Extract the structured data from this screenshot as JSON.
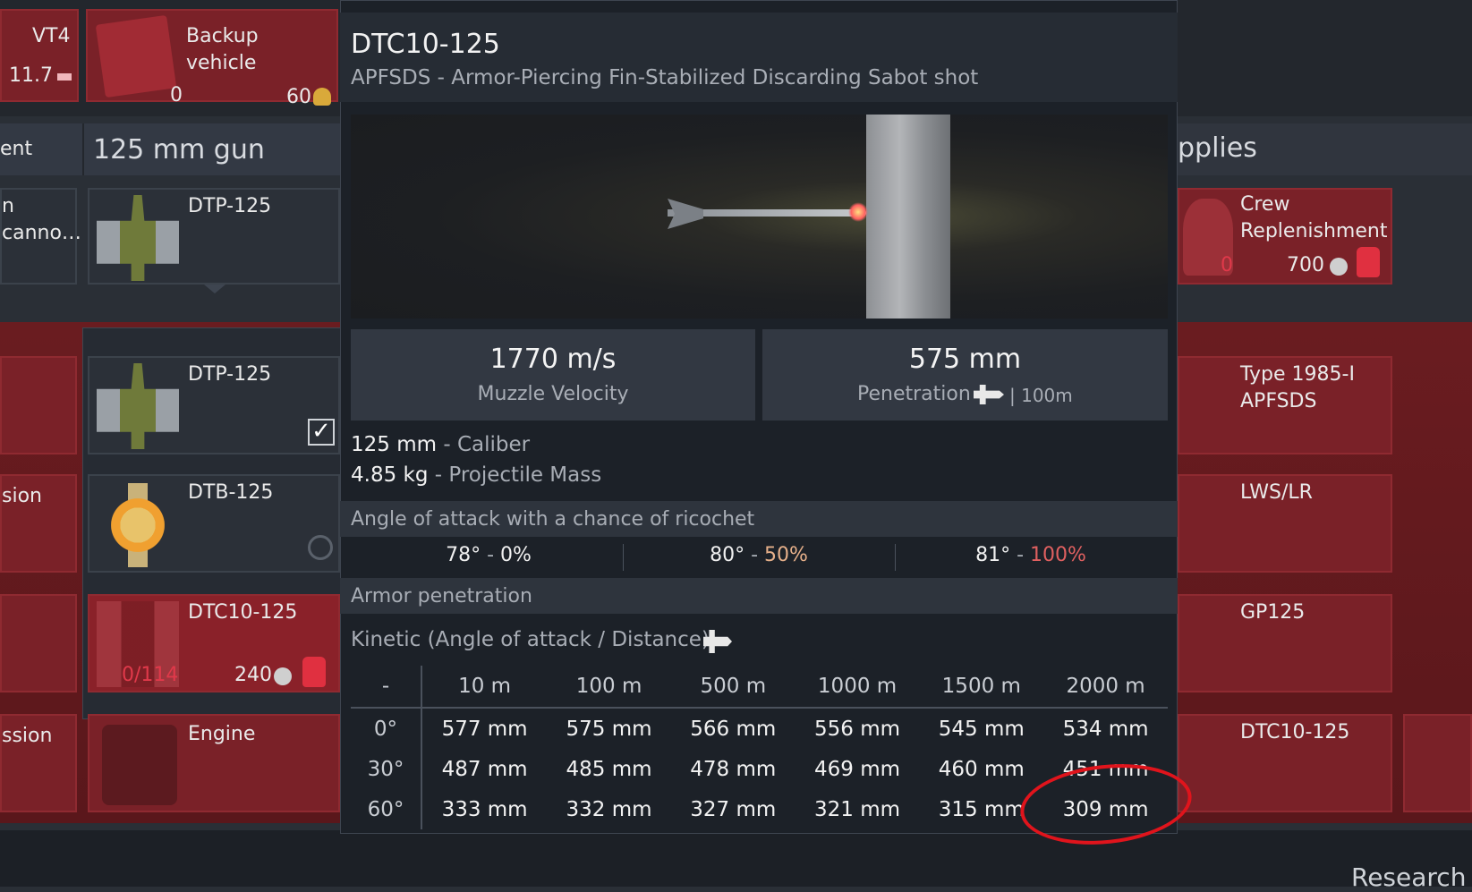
{
  "top_left": {
    "vehicle_name": "VT4",
    "vehicle_br": "11.7",
    "backup_label_line1": "Backup",
    "backup_label_line2": "vehicle",
    "backup_count": "0",
    "backup_cost": "60"
  },
  "headers": {
    "left_partial": "ent",
    "gun": "125 mm gun",
    "right_partial": "pplies"
  },
  "left_partials": {
    "item1_line1": "n",
    "item1_line2": "canno…",
    "item2": "sion",
    "item3": "ssion"
  },
  "ammo_column": {
    "selected_slot": "DTP-125",
    "items": [
      {
        "name": "DTP-125",
        "state": "checked"
      },
      {
        "name": "DTB-125",
        "state": "radio"
      },
      {
        "name": "DTC10-125",
        "progress": "0/114",
        "cost": "240"
      }
    ],
    "engine": "Engine"
  },
  "right_column": {
    "crew_line1": "Crew",
    "crew_line2": "Replenishment",
    "crew_count": "0",
    "crew_cost": "700",
    "type1985_line1": "Type 1985-I",
    "type1985_line2": "APFSDS",
    "lws": "LWS/LR",
    "gp": "GP125",
    "dtc": "DTC10-125"
  },
  "tooltip": {
    "title": "DTC10-125",
    "subtitle": "APFSDS - Armor-Piercing Fin-Stabilized Discarding Sabot shot",
    "muzzle_velocity": "1770 m/s",
    "muzzle_velocity_label": "Muzzle Velocity",
    "penetration": "575 mm",
    "penetration_label": "Penetration",
    "penetration_distance": "| 100m",
    "caliber_value": "125 mm",
    "caliber_label": "- Caliber",
    "mass_value": "4.85 kg",
    "mass_label": "- Projectile Mass",
    "ricochet_header": "Angle of attack with a chance of ricochet",
    "ricochet": [
      {
        "angle": "78°",
        "sep": " - ",
        "pct": "0%"
      },
      {
        "angle": "80°",
        "sep": " - ",
        "pct": "50%"
      },
      {
        "angle": "81°",
        "sep": " - ",
        "pct": "100%"
      }
    ],
    "armor_header": "Armor penetration",
    "kinetic_label": "Kinetic (Angle of attack / Distance)",
    "table": {
      "corner": "-",
      "distances": [
        "10 m",
        "100 m",
        "500 m",
        "1000 m",
        "1500 m",
        "2000 m"
      ],
      "rows": [
        {
          "angle": "0°",
          "values": [
            "577 mm",
            "575 mm",
            "566 mm",
            "556 mm",
            "545 mm",
            "534 mm"
          ]
        },
        {
          "angle": "30°",
          "values": [
            "487 mm",
            "485 mm",
            "478 mm",
            "469 mm",
            "460 mm",
            "451 mm"
          ]
        },
        {
          "angle": "60°",
          "values": [
            "333 mm",
            "332 mm",
            "327 mm",
            "321 mm",
            "315 mm",
            "309 mm"
          ]
        }
      ]
    }
  },
  "bottom": {
    "research": "Research"
  },
  "colors": {
    "accent_red": "#e0394a",
    "annotation_red": "#e0141c",
    "tooltip_bg": "#1c2128"
  }
}
